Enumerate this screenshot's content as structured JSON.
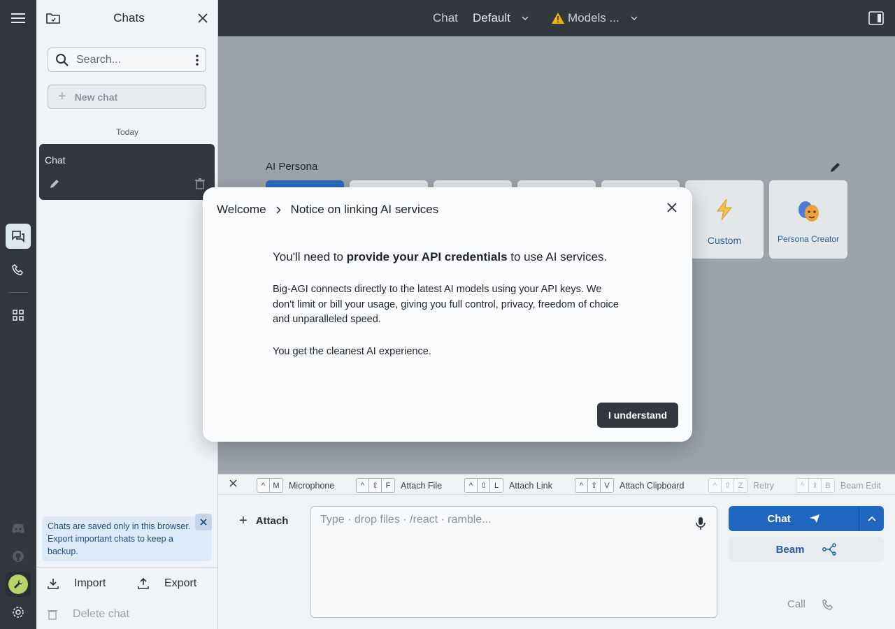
{
  "sidebar": {
    "title": "Chats",
    "search_placeholder": "Search...",
    "new_chat_label": "New chat",
    "section_today": "Today",
    "chat_item_label": "Chat",
    "notice_text": "Chats are saved only in this browser. Export important chats to keep a backup.",
    "import_label": "Import",
    "export_label": "Export",
    "delete_label": "Delete chat"
  },
  "topbar": {
    "chat_label": "Chat",
    "persona_select": "Default",
    "models_label": "Models ..."
  },
  "main": {
    "persona_title": "AI Persona",
    "personas": [
      {
        "name": "Custom",
        "icon": "lightning-icon"
      },
      {
        "name": "Persona Creator",
        "icon": "theater-masks-icon"
      }
    ]
  },
  "shortcuts": [
    {
      "keys": [
        "^",
        "M"
      ],
      "label": "Microphone"
    },
    {
      "keys": [
        "^",
        "⇧",
        "F"
      ],
      "label": "Attach File"
    },
    {
      "keys": [
        "^",
        "⇧",
        "L"
      ],
      "label": "Attach Link"
    },
    {
      "keys": [
        "^",
        "⇧",
        "V"
      ],
      "label": "Attach Clipboard"
    },
    {
      "keys": [
        "^",
        "⇧",
        "Z"
      ],
      "label": "Retry"
    },
    {
      "keys": [
        "^",
        "⇧",
        "B"
      ],
      "label": "Beam Edit"
    }
  ],
  "composer": {
    "attach_label": "Attach",
    "placeholder": "Type · drop files · /react · ramble...",
    "chat_button": "Chat",
    "beam_button": "Beam",
    "call_button": "Call"
  },
  "modal": {
    "breadcrumb_root": "Welcome",
    "breadcrumb_current": "Notice on linking AI services",
    "lead_prefix": "You'll need to ",
    "lead_bold": "provide your API credentials",
    "lead_suffix": " to use AI services.",
    "paragraph1": "Big-AGI connects directly to the latest AI models using your API keys. We don't limit or bill your usage, giving you full control, privacy, freedom of choice and unparalleled speed.",
    "paragraph2": "You get the cleanest AI experience.",
    "confirm_button": "I understand"
  },
  "colors": {
    "rail_bg": "#32383e",
    "accent_blue": "#1f66c1",
    "warning_yellow": "#f0b400"
  }
}
